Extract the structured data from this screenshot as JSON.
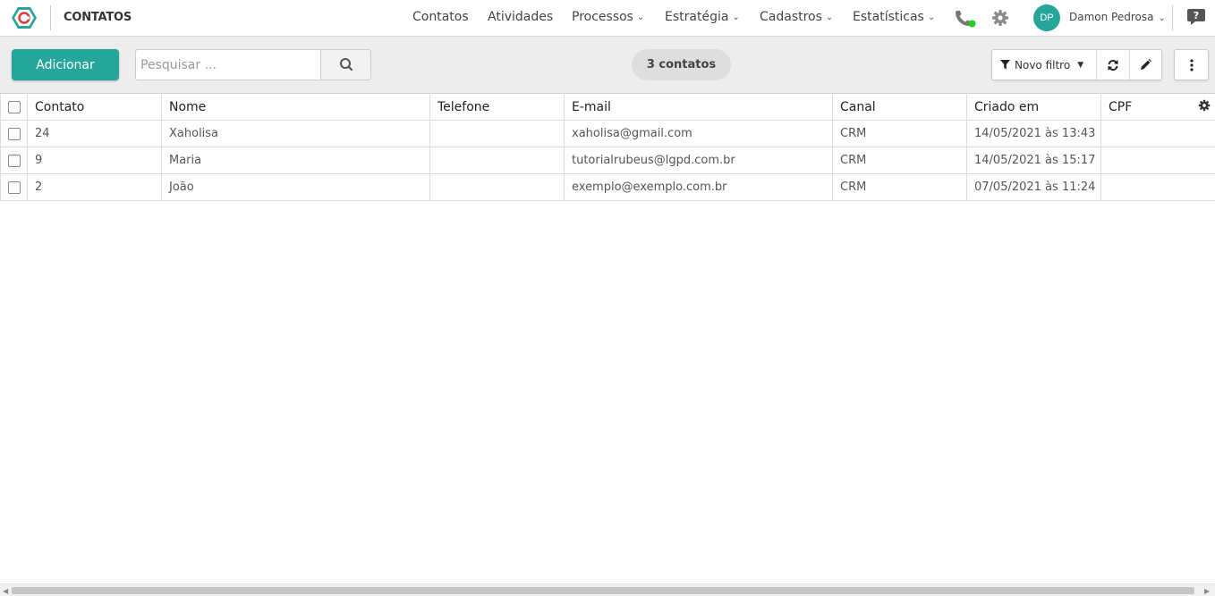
{
  "header": {
    "title": "CONTATOS",
    "nav": [
      {
        "label": "Contatos",
        "dropdown": false
      },
      {
        "label": "Atividades",
        "dropdown": false
      },
      {
        "label": "Processos",
        "dropdown": true
      },
      {
        "label": "Estratégia",
        "dropdown": true
      },
      {
        "label": "Cadastros",
        "dropdown": true
      },
      {
        "label": "Estatísticas",
        "dropdown": true
      }
    ],
    "user": {
      "initials": "DP",
      "name": "Damon Pedrosa"
    },
    "phone_status_color": "#22cc22",
    "accent_color": "#26a69a"
  },
  "toolbar": {
    "add_label": "Adicionar",
    "search_placeholder": "Pesquisar ...",
    "count_label": "3 contatos",
    "filter_label": "Novo filtro"
  },
  "table": {
    "columns": [
      "Contato",
      "Nome",
      "Telefone",
      "E-mail",
      "Canal",
      "Criado em",
      "CPF"
    ],
    "rows": [
      [
        "24",
        "Xaholisa",
        "",
        "xaholisa@gmail.com",
        "CRM",
        "14/05/2021 às 13:43",
        ""
      ],
      [
        "9",
        "Maria",
        "",
        "tutorialrubeus@lgpd.com.br",
        "CRM",
        "14/05/2021 às 15:17",
        ""
      ],
      [
        "2",
        "João",
        "",
        "exemplo@exemplo.com.br",
        "CRM",
        "07/05/2021 às 11:24",
        ""
      ]
    ]
  }
}
